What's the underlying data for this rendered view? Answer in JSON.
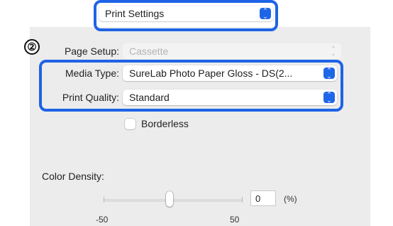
{
  "top_popup": {
    "value": "Print Settings"
  },
  "step_marker": "②",
  "page_setup": {
    "label": "Page Setup:",
    "value": "Cassette"
  },
  "media_type": {
    "label": "Media Type:",
    "value": "SureLab Photo Paper Gloss - DS(2..."
  },
  "print_quality": {
    "label": "Print Quality:",
    "value": "Standard"
  },
  "borderless": {
    "label": "Borderless",
    "checked": false
  },
  "color_density": {
    "label": "Color Density:",
    "value": "0",
    "unit": "(%)",
    "min_label": "-50",
    "max_label": "50",
    "slider_value": 0
  },
  "colors": {
    "accent": "#1e63e6",
    "panel": "#ececec"
  },
  "icons": {
    "popup_stepper": "up-down-chevron-icon"
  }
}
